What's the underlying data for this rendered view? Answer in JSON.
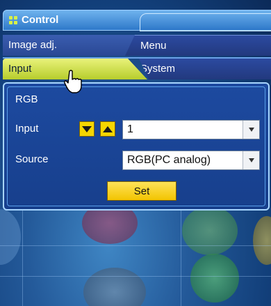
{
  "window": {
    "title": "Control"
  },
  "tabs": [
    {
      "label": "Image adj.",
      "active": false
    },
    {
      "label": "Menu",
      "active": false
    },
    {
      "label": "Input",
      "active": true
    },
    {
      "label": "System",
      "active": false
    }
  ],
  "panel": {
    "section_title": "RGB",
    "input_label": "Input",
    "input_value": "1",
    "source_label": "Source",
    "source_value": "RGB(PC analog)",
    "set_button": "Set"
  },
  "icons": {
    "title": "grid-icon",
    "down": "triangle-down-icon",
    "up": "triangle-up-icon",
    "dropdown": "chevron-down-icon",
    "cursor": "hand-pointer-icon"
  },
  "colors": {
    "accent_yellow": "#f6d600",
    "active_tab": "#d2e04a",
    "panel_bg": "#1d4aa0"
  }
}
